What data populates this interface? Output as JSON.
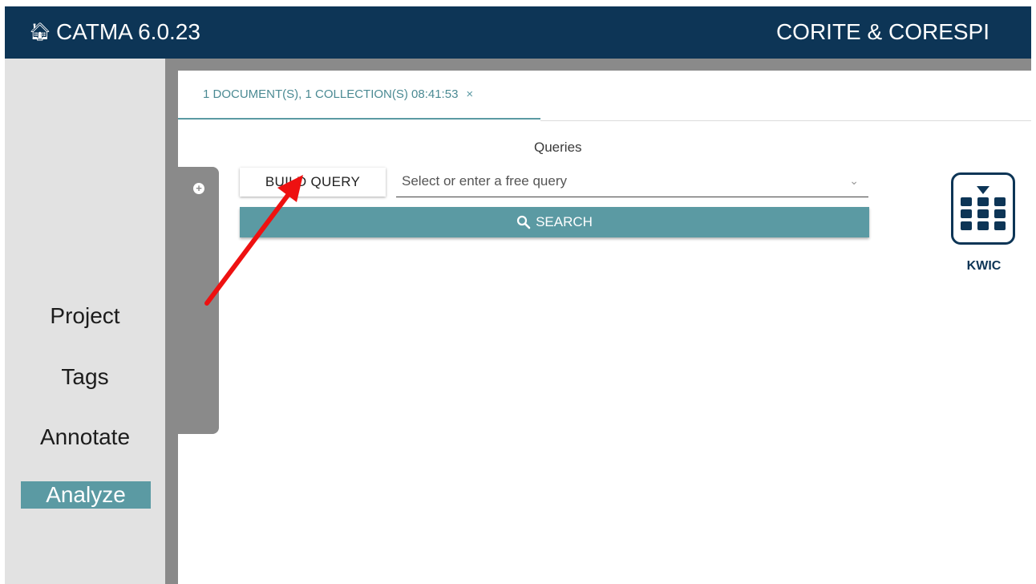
{
  "header": {
    "app_title": "CATMA 6.0.23",
    "home_icon": "home-icon",
    "project_name": "CORITE & CORESPI",
    "background_color": "#0d3556"
  },
  "sidebar": {
    "items": [
      {
        "label": "Project",
        "active": false
      },
      {
        "label": "Tags",
        "active": false
      },
      {
        "label": "Annotate",
        "active": false
      },
      {
        "label": "Analyze",
        "active": true
      }
    ],
    "active_color": "#5b9aa3"
  },
  "tabs": [
    {
      "label": "1 DOCUMENT(S), 1 COLLECTION(S) 08:41:53",
      "close_label": "×",
      "active": true
    }
  ],
  "queries": {
    "heading": "Queries",
    "build_query_label": "BUILD QUERY",
    "query_placeholder": "Select or enter a free query",
    "query_value": "",
    "search_label": "SEARCH",
    "search_icon": "search-icon",
    "accent_color": "#5b9aa3"
  },
  "visualizations": [
    {
      "label": "KWIC",
      "icon": "kwic-grid-icon"
    }
  ],
  "annotation": {
    "icon": "red-arrow-icon",
    "color": "#ee1111"
  }
}
